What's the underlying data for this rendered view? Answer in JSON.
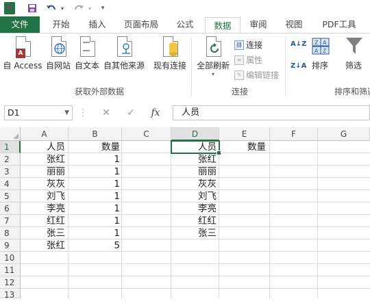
{
  "qat": {
    "logo": "X",
    "save_icon": "save-icon",
    "undo_icon": "undo-icon",
    "redo_icon": "redo-icon"
  },
  "tabs": [
    "文件",
    "开始",
    "插入",
    "页面布局",
    "公式",
    "数据",
    "审阅",
    "视图",
    "PDF工具"
  ],
  "ribbon": {
    "get_external": {
      "buttons": [
        "自 Access",
        "自网站",
        "自文本",
        "自其他来源",
        "现有连接"
      ],
      "group_label": "获取外部数据"
    },
    "connections": {
      "refresh_all": "全部刷新",
      "small": [
        "连接",
        "属性",
        "编辑链接"
      ],
      "group_label": "连接"
    },
    "sort_filter": {
      "sort_label": "排序",
      "filter_label": "筛选",
      "group_label": "排序和筛选",
      "az": "A↓Z",
      "za": "Z↓A"
    }
  },
  "formula_bar": {
    "name_box": "D1",
    "fx": "fx",
    "content": "人员",
    "cancel": "✕",
    "enter": "✓"
  },
  "columns": [
    "A",
    "B",
    "C",
    "D",
    "E",
    "F",
    "G"
  ],
  "rows": [
    "1",
    "2",
    "3",
    "4",
    "5",
    "6",
    "7",
    "8",
    "9",
    "10",
    "11",
    "12",
    "13"
  ],
  "cells": {
    "A": [
      "人员",
      "张红",
      "丽丽",
      "灰灰",
      "刘飞",
      "李亮",
      "红红",
      "张三",
      "张红"
    ],
    "B": [
      "数量",
      "1",
      "1",
      "1",
      "1",
      "1",
      "1",
      "1",
      "5"
    ],
    "D": [
      "人员",
      "张红",
      "丽丽",
      "灰灰",
      "刘飞",
      "李亮",
      "红红",
      "张三"
    ],
    "E": [
      "数量"
    ]
  },
  "colors": {
    "accent": "#217346",
    "access_red": "#a4373a",
    "filter_gray": "#7f7f7f"
  }
}
